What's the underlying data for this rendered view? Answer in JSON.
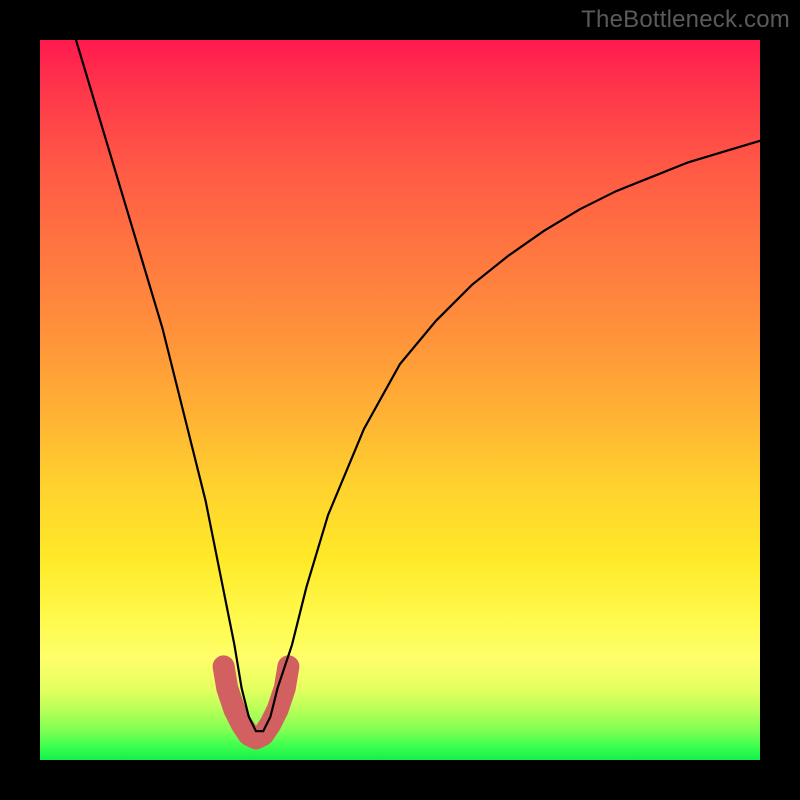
{
  "watermark": "TheBottleneck.com",
  "chart_data": {
    "type": "line",
    "title": "",
    "xlabel": "",
    "ylabel": "",
    "xlim": [
      0,
      100
    ],
    "ylim": [
      0,
      100
    ],
    "series": [
      {
        "name": "black-curve",
        "x": [
          5,
          8,
          11,
          14,
          17,
          20,
          23,
          25,
          27,
          28,
          29,
          30,
          31,
          32,
          33,
          35,
          37,
          40,
          45,
          50,
          55,
          60,
          65,
          70,
          75,
          80,
          85,
          90,
          95,
          100
        ],
        "values": [
          100,
          90,
          80,
          70,
          60,
          48,
          36,
          26,
          16,
          10,
          6,
          4,
          4,
          6,
          10,
          16,
          24,
          34,
          46,
          55,
          61,
          66,
          70,
          73.5,
          76.5,
          79,
          81,
          83,
          84.5,
          86
        ]
      },
      {
        "name": "red-marker-band",
        "x": [
          25.5,
          26,
          27,
          28,
          29,
          30,
          31,
          32,
          33,
          34,
          34.5
        ],
        "values": [
          13,
          10,
          7,
          5,
          3.5,
          3,
          3.5,
          5,
          7,
          10,
          13
        ]
      }
    ]
  }
}
